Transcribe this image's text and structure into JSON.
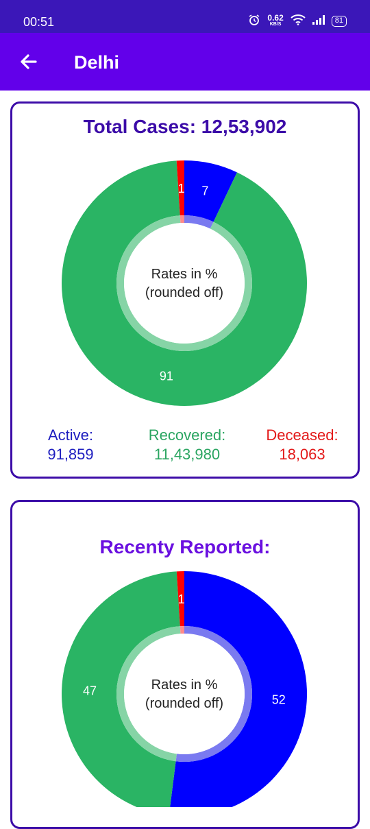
{
  "status_bar": {
    "time": "00:51",
    "net_speed_value": "0.62",
    "net_speed_unit": "KB/S",
    "battery": "81"
  },
  "app_bar": {
    "title": "Delhi"
  },
  "total_card": {
    "title": "Total Cases: 12,53,902",
    "center_text_line1": "Rates in %",
    "center_text_line2": "(rounded off)",
    "legend": {
      "active_label": "Active:",
      "active_value": "91,859",
      "recovered_label": "Recovered:",
      "recovered_value": "11,43,980",
      "deceased_label": "Deceased:",
      "deceased_value": "18,063"
    }
  },
  "recent_card": {
    "title": "Recenty Reported:",
    "center_text_line1": "Rates in %",
    "center_text_line2": "(rounded off)"
  },
  "colors": {
    "active": "#0000ff",
    "recovered": "#2ab464",
    "deceased": "#ff0000",
    "header": "#6200ea"
  },
  "chart_data": [
    {
      "type": "pie",
      "categories": [
        "Active",
        "Recovered",
        "Deceased"
      ],
      "values": [
        7,
        91,
        1
      ],
      "labels": [
        "7",
        "91",
        "1"
      ]
    },
    {
      "type": "pie",
      "categories": [
        "Active",
        "Recovered",
        "Deceased"
      ],
      "values": [
        52,
        47,
        1
      ],
      "labels": [
        "52",
        "47",
        "1"
      ]
    }
  ]
}
